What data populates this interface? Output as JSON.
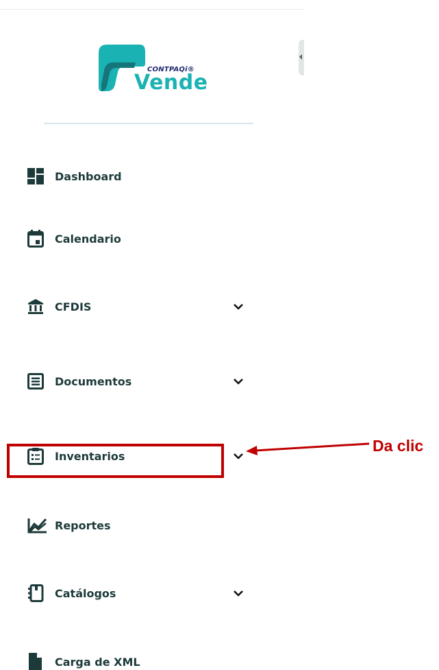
{
  "logo": {
    "sub_text": "CONTPAQi®",
    "main_text": "Vende",
    "colors": {
      "teal": "#1bb2b4",
      "teal_dark": "#14757a",
      "navy": "#1e2a6f"
    }
  },
  "nav": {
    "items": [
      {
        "label": "Dashboard",
        "icon": "dashboard-icon",
        "has_submenu": false
      },
      {
        "label": "Calendario",
        "icon": "calendar-icon",
        "has_submenu": false
      },
      {
        "label": "CFDIS",
        "icon": "bank-icon",
        "has_submenu": true
      },
      {
        "label": "Documentos",
        "icon": "documents-icon",
        "has_submenu": true
      },
      {
        "label": "Inventarios",
        "icon": "clipboard-list-icon",
        "has_submenu": true
      },
      {
        "label": "Reportes",
        "icon": "chart-line-icon",
        "has_submenu": false
      },
      {
        "label": "Catálogos",
        "icon": "catalog-book-icon",
        "has_submenu": true
      },
      {
        "label": "Carga de XML",
        "icon": "file-icon",
        "has_submenu": false
      }
    ]
  },
  "annotation": {
    "text": "Da clic",
    "color": "#c00000"
  }
}
